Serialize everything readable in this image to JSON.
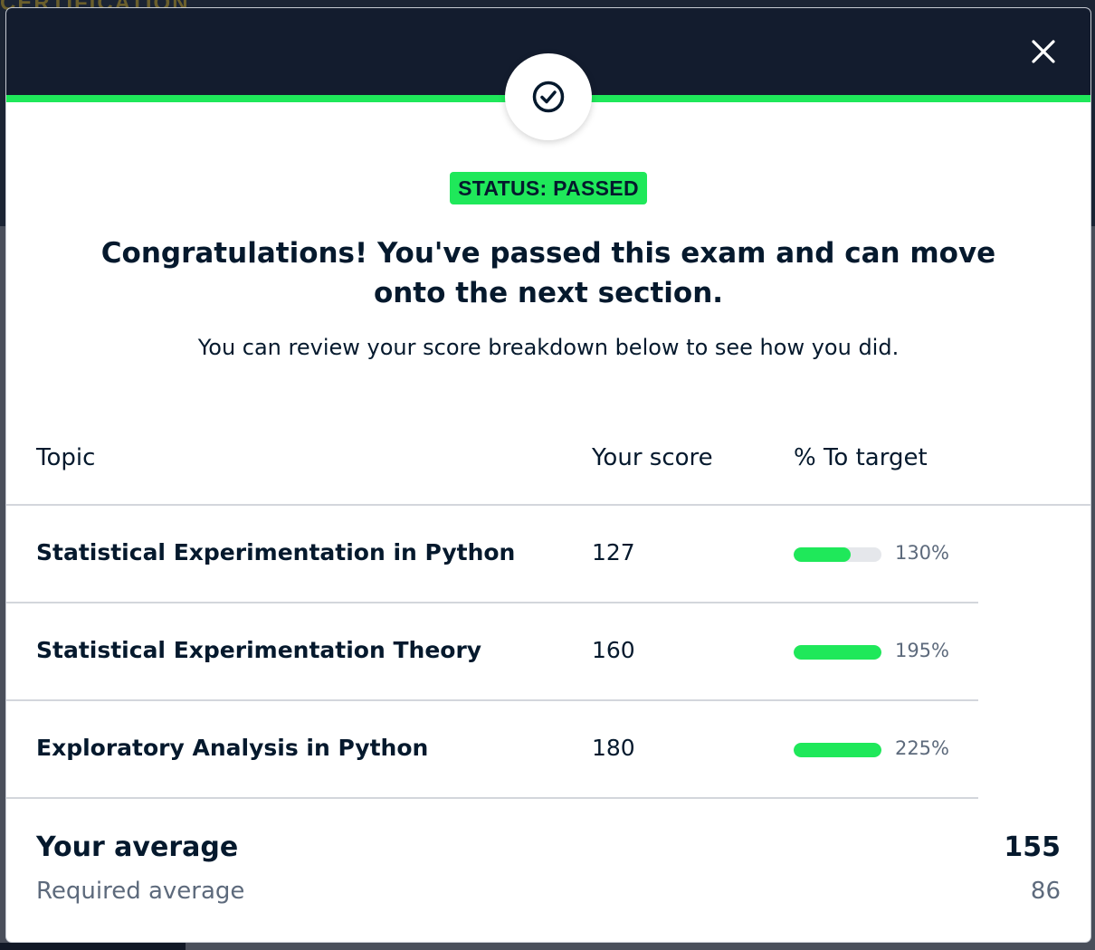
{
  "backdrop": {
    "heading_fragment": "CERTIFICATION"
  },
  "modal": {
    "close_icon": "close-icon",
    "status_icon": "check-circle-icon",
    "status_badge": "STATUS: PASSED",
    "headline": "Congratulations! You've passed this exam and can move onto the next section.",
    "subline": "You can review your score breakdown below to see how you did."
  },
  "table": {
    "headers": {
      "topic": "Topic",
      "score": "Your score",
      "target": "% To target"
    },
    "rows": [
      {
        "topic": "Statistical Experimentation in Python",
        "score": "127",
        "pct": "130%",
        "bar_fill": 0.65
      },
      {
        "topic": "Statistical Experimentation Theory",
        "score": "160",
        "pct": "195%",
        "bar_fill": 1.0
      },
      {
        "topic": "Exploratory Analysis in Python",
        "score": "180",
        "pct": "225%",
        "bar_fill": 1.0
      }
    ]
  },
  "summary": {
    "your_average_label": "Your average",
    "your_average_value": "155",
    "required_average_label": "Required average",
    "required_average_value": "86"
  },
  "colors": {
    "header_bg": "#131c2e",
    "accent_green": "#1fe85a",
    "text_dark": "#05192d",
    "text_muted": "#5d6a7c"
  }
}
